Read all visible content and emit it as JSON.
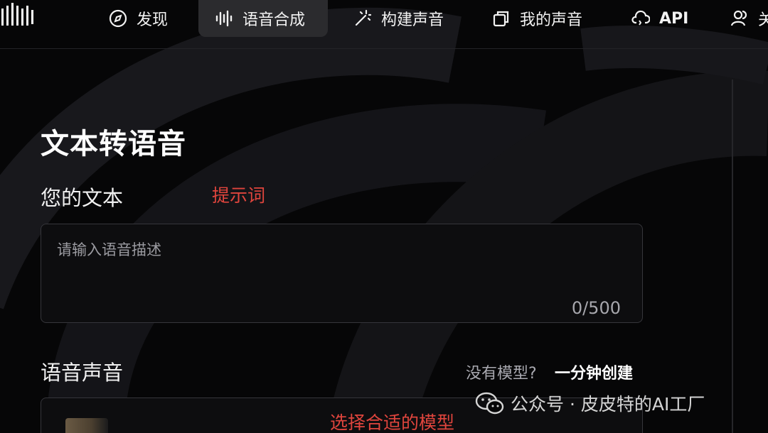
{
  "nav": {
    "items": [
      {
        "label": "发现",
        "icon": "compass-icon"
      },
      {
        "label": "语音合成",
        "icon": "waveform-icon",
        "active": true
      },
      {
        "label": "构建声音",
        "icon": "magic-wand-icon"
      },
      {
        "label": "我的声音",
        "icon": "cards-icon"
      },
      {
        "label": "API",
        "icon": "cloud-code-icon"
      },
      {
        "label": "关",
        "icon": "user-icon"
      }
    ]
  },
  "page": {
    "title": "文本转语音"
  },
  "text_section": {
    "label": "您的文本",
    "annotation": "提示词",
    "placeholder": "请输入语音描述",
    "value": "",
    "counter": "0/500"
  },
  "voice_section": {
    "label": "语音声音",
    "no_model": "没有模型?",
    "create_link": "一分钟创建",
    "annotation": "选择合适的模型"
  },
  "watermark": {
    "text": "公众号 · 皮皮特的AI工厂",
    "icon": "wechat-icon"
  },
  "colors": {
    "background": "#060607",
    "annotation_red": "#e0453d",
    "active_tab": "#2b2b2e"
  }
}
